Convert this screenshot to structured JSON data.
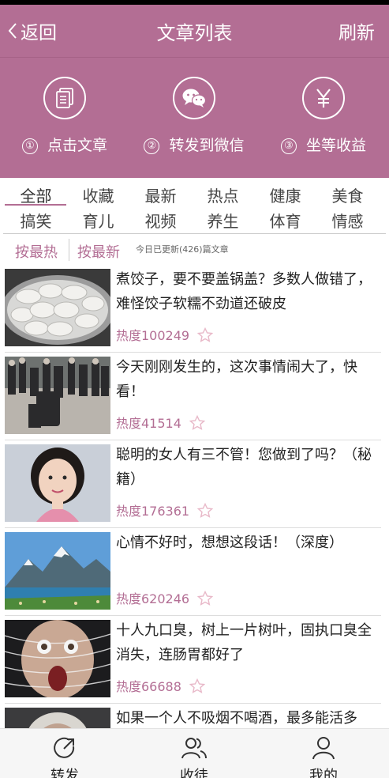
{
  "header": {
    "back_label": "返回",
    "title": "文章列表",
    "refresh_label": "刷新"
  },
  "steps": [
    {
      "num": "①",
      "label": "点击文章",
      "icon": "article-icon"
    },
    {
      "num": "②",
      "label": "转发到微信",
      "icon": "wechat-icon"
    },
    {
      "num": "③",
      "label": "坐等收益",
      "icon": "yuan-icon"
    }
  ],
  "categories": [
    "全部",
    "收藏",
    "最新",
    "热点",
    "健康",
    "美食",
    "搞笑",
    "育儿",
    "视频",
    "养生",
    "体育",
    "情感"
  ],
  "active_category": "全部",
  "sort": {
    "hot": "按最热",
    "new": "按最新",
    "info": "今日已更新(426)篇文章"
  },
  "articles": [
    {
      "title": "煮饺子，要不要盖锅盖？多数人做错了，难怪饺子软糯不劲道还破皮",
      "heat": "热度100249",
      "thumb": "dumplings"
    },
    {
      "title": "今天刚刚发生的，这次事情闹大了，快看！",
      "heat": "热度41514",
      "thumb": "crowd"
    },
    {
      "title": "聪明的女人有三不管！您做到了吗？（秘籍）",
      "heat": "热度176361",
      "thumb": "woman"
    },
    {
      "title": "心情不好时，想想这段话！（深度）",
      "heat": "热度620246",
      "thumb": "mountains"
    },
    {
      "title": "十人九口臭，树上一片树叶，固执口臭全消失，连肠胃都好了",
      "heat": "热度66688",
      "thumb": "face"
    },
    {
      "title": "如果一个人不吸烟不喝酒，最多能活多",
      "heat": "",
      "thumb": "elder"
    }
  ],
  "tabbar": [
    {
      "label": "转发",
      "icon": "share-icon"
    },
    {
      "label": "收徒",
      "icon": "users-icon"
    },
    {
      "label": "我的",
      "icon": "user-icon"
    }
  ],
  "colors": {
    "brand": "#b36e94",
    "heat_text": "#b36e94"
  }
}
